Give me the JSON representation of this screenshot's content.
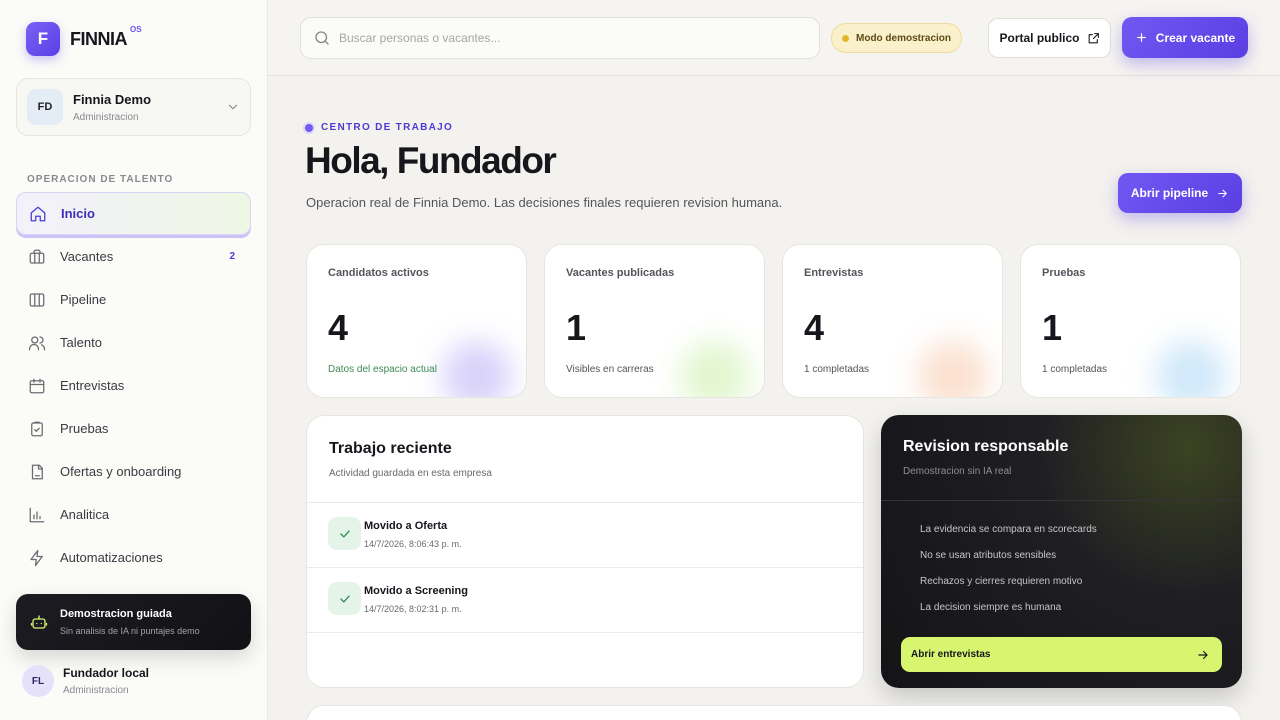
{
  "brand": {
    "logo_letter": "F",
    "name": "FINNIA",
    "sup": "OS"
  },
  "workspace": {
    "initials": "FD",
    "name": "Finnia Demo",
    "role": "Administracion"
  },
  "sidebar": {
    "section_label": "OPERACION DE TALENTO",
    "items": [
      {
        "label": "Inicio",
        "icon": "home-icon",
        "active": true
      },
      {
        "label": "Vacantes",
        "icon": "briefcase-icon",
        "badge": "2"
      },
      {
        "label": "Pipeline",
        "icon": "columns-icon"
      },
      {
        "label": "Talento",
        "icon": "users-icon"
      },
      {
        "label": "Entrevistas",
        "icon": "calendar-icon"
      },
      {
        "label": "Pruebas",
        "icon": "clipboard-check-icon"
      },
      {
        "label": "Ofertas y onboarding",
        "icon": "file-icon"
      },
      {
        "label": "Analitica",
        "icon": "bar-chart-icon"
      },
      {
        "label": "Automatizaciones",
        "icon": "lightning-icon"
      }
    ],
    "demo_card": {
      "title": "Demostracion guiada",
      "subtitle": "Sin analisis de IA ni puntajes demo"
    },
    "user": {
      "initials": "FL",
      "name": "Fundador local",
      "role": "Administracion"
    }
  },
  "topbar": {
    "search_placeholder": "Buscar personas o vacantes...",
    "demo_badge": "Modo demostracion",
    "portal_label": "Portal publico",
    "create_label": "Crear vacante"
  },
  "hero": {
    "eyebrow": "CENTRO DE TRABAJO",
    "title": "Hola, Fundador",
    "subtitle": "Operacion real de Finnia Demo. Las decisiones finales requieren revision humana.",
    "pipeline_button": "Abrir pipeline"
  },
  "stats": [
    {
      "label": "Candidatos activos",
      "value": "4",
      "note": "Datos del espacio actual",
      "glow": "#b9aef7"
    },
    {
      "label": "Vacantes publicadas",
      "value": "1",
      "note": "Visibles en carreras",
      "glow": "#c9f0a8"
    },
    {
      "label": "Entrevistas",
      "value": "4",
      "note": "1 completadas",
      "glow": "#f7c8a8"
    },
    {
      "label": "Pruebas",
      "value": "1",
      "note": "1 completadas",
      "glow": "#a9d6f5"
    }
  ],
  "recent": {
    "title": "Trabajo reciente",
    "subtitle": "Actividad guardada en esta empresa",
    "activities": [
      {
        "title": "Movido a Oferta",
        "time": "14/7/2026, 8:06:43 p. m."
      },
      {
        "title": "Movido a Screening",
        "time": "14/7/2026, 8:02:31 p. m."
      }
    ]
  },
  "review": {
    "title": "Revision responsable",
    "subtitle": "Demostracion sin IA real",
    "items": [
      "La evidencia se compara en scorecards",
      "No se usan atributos sensibles",
      "Rechazos y cierres requieren motivo",
      "La decision siempre es humana"
    ],
    "button": "Abrir entrevistas",
    "accent": "#d8f56f"
  }
}
